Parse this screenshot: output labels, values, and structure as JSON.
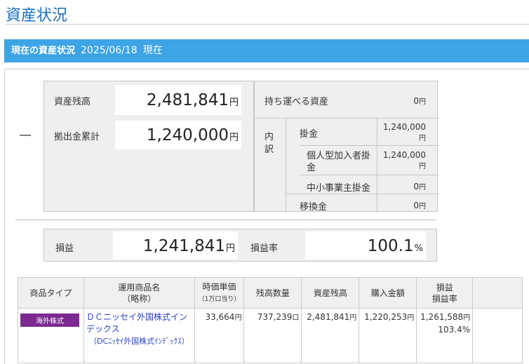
{
  "page": {
    "title": "資産状況"
  },
  "section": {
    "label": "現在の資産状況",
    "date": "2025/06/18",
    "now": "現在"
  },
  "summary": {
    "balance_label": "資産残高",
    "balance_value": "2,481,841",
    "contrib_label": "拠出金累計",
    "contrib_value": "1,240,000",
    "yen": "円",
    "portable_label": "持ち運べる資産",
    "portable_value": "0",
    "breakdown_label_1": "内",
    "breakdown_label_2": "訳",
    "kakekin_label": "掛金",
    "kakekin_value": "1,240,000",
    "personal_label": "個人型加入者掛金",
    "personal_value": "1,240,000",
    "sme_label": "中小事業主掛金",
    "sme_value": "0",
    "transfer_label": "移換金",
    "transfer_value": "0",
    "minus_sign": "—"
  },
  "profit": {
    "label": "損益",
    "value": "1,241,841",
    "rate_label": "損益率",
    "rate_value": "100.1",
    "pct": "%"
  },
  "holdings": {
    "headers": {
      "type": "商品タイプ",
      "name_1": "運用商品名",
      "name_2": "（略称）",
      "price_1": "時価単価",
      "price_2": "（1万口当り）",
      "qty": "残高数量",
      "balance": "資産残高",
      "purchase": "購入金額",
      "pl_1": "損益",
      "pl_2": "損益率"
    },
    "rows": [
      {
        "type": "海外株式",
        "name": "ＤＣニッセイ外国株式インデックス",
        "short": "（DCﾆｯｾｲ外国株式ｲﾝﾃﾞｯｸｽ）",
        "price": "33,664",
        "price_unit": "円",
        "qty": "737,239",
        "qty_unit": "口",
        "balance": "2,481,841",
        "balance_unit": "円",
        "purchase": "1,220,253",
        "purchase_unit": "円",
        "pl": "1,261,588",
        "pl_unit": "円",
        "pl_rate": "103.4%"
      }
    ]
  }
}
